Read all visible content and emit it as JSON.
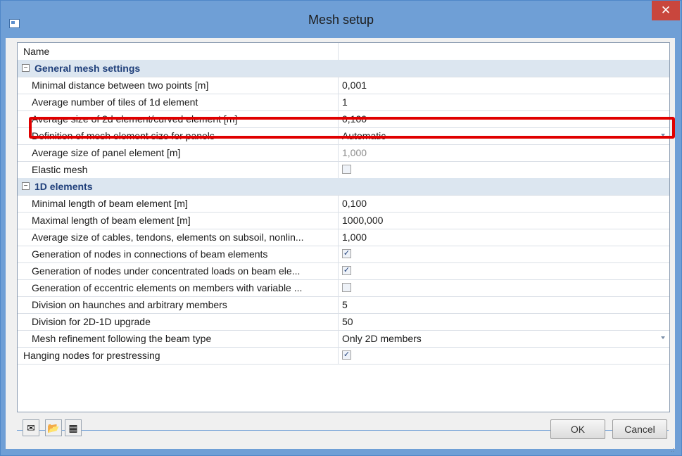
{
  "window": {
    "title": "Mesh setup",
    "close_glyph": "✕"
  },
  "grid": {
    "header": {
      "name": "Name",
      "value": ""
    },
    "groups": [
      {
        "title": "General mesh settings",
        "toggle": "−",
        "rows": [
          {
            "name": "Minimal distance between two points [m]",
            "value": "0,001"
          },
          {
            "name": "Average number of tiles of 1d element",
            "value": "1"
          },
          {
            "name": "Average size of 2d element/curved element [m]",
            "value": "0,100"
          },
          {
            "name": "Definition of mesh element size for panels",
            "value": "Automatic"
          },
          {
            "name": "Average size of panel element [m]",
            "value": "1,000"
          },
          {
            "name": "Elastic mesh",
            "checked": false
          }
        ]
      },
      {
        "title": "1D elements",
        "toggle": "−",
        "rows": [
          {
            "name": "Minimal length of beam element [m]",
            "value": "0,100"
          },
          {
            "name": "Maximal length of beam element [m]",
            "value": "1000,000"
          },
          {
            "name": "Average size of cables, tendons, elements on subsoil, nonlin...",
            "value": "1,000"
          },
          {
            "name": "Generation of nodes in connections of beam elements",
            "checked": true
          },
          {
            "name": "Generation of nodes under concentrated loads on beam ele...",
            "checked": true
          },
          {
            "name": "Generation of eccentric elements on members with variable ...",
            "checked": false
          },
          {
            "name": "Division on haunches and arbitrary members",
            "value": "5"
          },
          {
            "name": "Division for 2D-1D upgrade",
            "value": "50"
          },
          {
            "name": "Mesh refinement following the beam type",
            "value": "Only 2D members"
          }
        ]
      }
    ],
    "footer_row": {
      "name": "Hanging nodes for prestressing",
      "checked": true
    }
  },
  "toolbar": {
    "icons": [
      "default-settings-icon",
      "open-folder-icon",
      "save-icon"
    ],
    "ok_label": "OK",
    "cancel_label": "Cancel"
  },
  "accent_color": "#6f9fd6",
  "highlight_color": "#e00000"
}
